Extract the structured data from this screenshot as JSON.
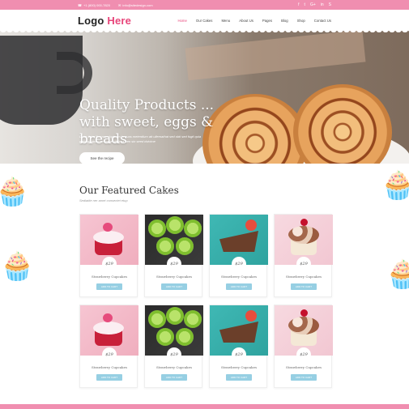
{
  "topbar": {
    "phone": "+1 (800) 000-7820",
    "email": "info@sitedesign.com",
    "social_icons": [
      "facebook-icon",
      "twitter-icon",
      "google-plus-icon",
      "linkedin-icon",
      "skype-icon"
    ],
    "social_glyphs": [
      "f",
      "t",
      "G+",
      "in",
      "S"
    ]
  },
  "header": {
    "logo_main": "Logo ",
    "logo_accent": "Here",
    "nav": [
      "Home",
      "Our Cakes",
      "Menu",
      "About Us",
      "Pages",
      "Blog",
      "Shop",
      "Contact Us"
    ]
  },
  "hero": {
    "title_line1": "Quality Products ...",
    "title_line2": "with sweet, eggs & breads",
    "subtitle": "Dolor iluim liberra puluptusm ia quas meterdium att ullernathat sed obti sed fugit quia exeraptpasmuse fugher dolerta ben sin seed dvicime",
    "button": "See the recipe"
  },
  "featured": {
    "title": "Our Featured Cakes",
    "subtitle": "Sediatite ner amet consectet etup",
    "cards": [
      {
        "price": "$29",
        "name": "Strawberry Cupcakes",
        "button": "ADD TO CART",
        "style": "pink"
      },
      {
        "price": "$29",
        "name": "Strawberry Cupcakes",
        "button": "ADD TO CART",
        "style": "green"
      },
      {
        "price": "$29",
        "name": "Strawberry Cupcakes",
        "button": "ADD TO CART",
        "style": "teal"
      },
      {
        "price": "$29",
        "name": "Strawberry Cupcakes",
        "button": "ADD TO CART",
        "style": "rose"
      },
      {
        "price": "$29",
        "name": "Strawberry Cupcakes",
        "button": "ADD TO CART",
        "style": "pink"
      },
      {
        "price": "$29",
        "name": "Strawberry Cupcakes",
        "button": "ADD TO CART",
        "style": "green"
      },
      {
        "price": "$29",
        "name": "Strawberry Cupcakes",
        "button": "ADD TO CART",
        "style": "teal"
      },
      {
        "price": "$29",
        "name": "Strawberry Cupcakes",
        "button": "ADD TO CART",
        "style": "rose"
      }
    ]
  },
  "colors": {
    "accent": "#e8457a",
    "topbar": "#f08eb0",
    "button": "#96cfe3"
  }
}
